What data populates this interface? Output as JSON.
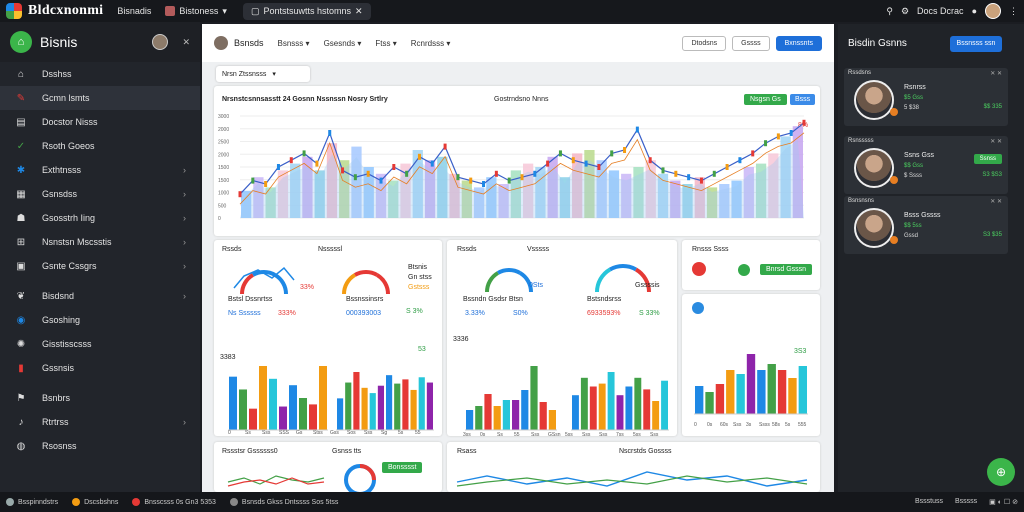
{
  "topbar": {
    "brand": "Bldcxnonmi",
    "menu1": "Bisnadis",
    "menu2": "Bistoness",
    "pill": "Pontstsuwtts hstomns",
    "right_label": "Docs Dcrac"
  },
  "sidebar": {
    "title": "Bisnis",
    "items": [
      {
        "label": "Dsshss",
        "icon": "home-icon"
      },
      {
        "label": "Gcmn lsmts",
        "icon": "pen-icon",
        "active": true
      },
      {
        "label": "Docstor Nisss",
        "icon": "document-icon"
      },
      {
        "label": "Rsoth Goeos",
        "icon": "check-icon"
      },
      {
        "label": "Exthtnsss",
        "icon": "puzzle-icon",
        "chev": true
      },
      {
        "label": "Gsnsdss",
        "icon": "grid-icon",
        "chev": true
      },
      {
        "label": "Gsosstrh Iing",
        "icon": "user-icon",
        "chev": true
      },
      {
        "label": "Nsnstsn Mscsstis",
        "icon": "plus-icon",
        "chev": true
      },
      {
        "label": "Gsnte Cssgrs",
        "icon": "lock-icon",
        "chev": true
      },
      {
        "label": "Bisdsnd",
        "icon": "leaf-icon",
        "chev": true
      },
      {
        "label": "Gsoshing",
        "icon": "circle-icon"
      },
      {
        "label": "Gisstisscsss",
        "icon": "settings-icon"
      },
      {
        "label": "Gssnsis",
        "icon": "chart-icon"
      },
      {
        "label": "Bsnbrs",
        "icon": "flag-icon"
      },
      {
        "label": "Rtrtrss",
        "icon": "bell-icon",
        "chev": true
      },
      {
        "label": "Rsosnss",
        "icon": "globe-icon"
      }
    ]
  },
  "toolbar": {
    "title": "Bsnsds",
    "dd1": "Bsnsss",
    "dd2": "Gsesnds",
    "dd3": "Ftss",
    "dd4": "Rcnrdsss",
    "btn1": "Dtodsns",
    "btn2": "Gssss",
    "btn3": "Bxnssnts"
  },
  "filter": "Nrsn Ztssnsss",
  "main_chart": {
    "title": "Nrsnstcsnnsasstt 24 Gosnn Nssnssn Nosry Srtlry",
    "title2": "Gostrndsno Nnns",
    "btn_green": "Nsgsn Gs",
    "btn_blue": "Bsss",
    "legend_red": "8%",
    "y_ticks": [
      "3000",
      "2000",
      "2500",
      "2000",
      "1500",
      "1500",
      "1000",
      "500",
      "0"
    ]
  },
  "card_a": {
    "t1": "Rssds",
    "t2": "Nsssssl",
    "g1_label": "Bstsl Dssnrtss",
    "g2_label": "Bssnssinsrs",
    "g1_val": "33%",
    "g2_pre": "Gstsss",
    "g1_pct": "333%",
    "g1_sub": "Ns Ssssss",
    "g2_sub": "000393003",
    "g2_pct": "S 3%",
    "g2_top": "Btsnis",
    "g2_top2": "Gn stss",
    "ylab": "3383",
    "bar_top": "53",
    "xlabels": [
      "0",
      "Ss",
      "Sss",
      "SSS",
      "Gs",
      "Stss",
      "Gss",
      "Sos",
      "Sss",
      "Sg",
      "5s",
      "55"
    ]
  },
  "card_b": {
    "t1": "Rssds",
    "t2": "Vsssss",
    "g1_label": "Bssndn Gsdsr Btsn",
    "g2_label": "Bstsndsrss",
    "g1_val": "0Sts",
    "g2_val": "Gssssis",
    "g1_sub": "3.33%",
    "g1_sub2": "S0%",
    "g2_sub": "6933593%",
    "g2_sub2": "S 33%",
    "ylab": "3336",
    "xlabels": [
      "3ss",
      "0s",
      "Ss",
      "55",
      "Sss",
      "GSsn",
      "5ss",
      "Sss",
      "Sss",
      "7ss",
      "5ss",
      "Sss"
    ]
  },
  "card_c": {
    "t1": "Rnsss Ssss",
    "btn": "Bnrsd Gsssn",
    "ylab": "3S3",
    "xlabels": [
      "0",
      "0s",
      "60s",
      "Sss",
      "3s",
      "Ssss",
      "58s",
      "5s",
      "555"
    ]
  },
  "card_d": {
    "t1": "Rssstsr Gssssss0",
    "t2": "Gsnss tts",
    "btn": "Bonsssst",
    "sub": "Brsnsr Bssss",
    "ylab": "6s",
    "ylab2": "1s"
  },
  "card_e": {
    "t1": "Rsass",
    "t2": "Nscrstds Gossss"
  },
  "rpanel": {
    "title": "Bisdin Gsnns",
    "btn": "Bssnsss ssn",
    "people": [
      {
        "name": "Rssdsns",
        "l1": "Rsnrss",
        "l2": "$5 Gss",
        "l3": "5 $38",
        "num": "$$ 335"
      },
      {
        "name": "Rsnsssss",
        "l1": "Ssns Gss",
        "l2": "$$ Gss",
        "l3": "$ Ssss",
        "num": "S3 $S3",
        "btn": "Ssnss"
      },
      {
        "name": "Bsnsnsns",
        "l1": "Bsss Gssss",
        "l2": "$$ 5ss",
        "l3": "Gssd",
        "num": "S3 $35"
      }
    ]
  },
  "statusbar": {
    "s1": "Bsspinndstrs",
    "s2": "Dscsbshns",
    "s3": "Bnsscsss 0s Gn3 5353",
    "s4": "Bsnsds Gkss Dntssss Sos 5tss",
    "r1": "Bssstuss",
    "r2": "Bsssss"
  },
  "chart_data": [
    {
      "type": "bar",
      "title": "Nrsnstcsnnsasstt 24 Gosnn Nssnssn Nosry Srtlry",
      "series": [
        {
          "name": "bars",
          "values": [
            800,
            1200,
            900,
            1400,
            1600,
            1800,
            1400,
            2200,
            1700,
            2100,
            1500,
            1300,
            1100,
            1600,
            2000,
            1700,
            1800,
            1300,
            1100,
            900,
            1200,
            1000,
            1400,
            1600,
            1500,
            1800,
            1200,
            1900,
            2000,
            1700,
            1400,
            1300,
            1500,
            1700,
            1300,
            1100,
            1000,
            1200,
            900,
            1000,
            1100,
            1500,
            1600,
            1900,
            2400,
            2700
          ]
        },
        {
          "name": "line",
          "values": [
            700,
            1100,
            1000,
            1500,
            1700,
            1900,
            1600,
            2500,
            1400,
            1200,
            1300,
            1100,
            1500,
            1300,
            1800,
            1600,
            2100,
            1200,
            1100,
            1000,
            1300,
            1100,
            1200,
            1300,
            1600,
            1900,
            1700,
            1600,
            1500,
            1900,
            2000,
            2600,
            1700,
            1400,
            1300,
            1200,
            1100,
            1300,
            1500,
            1700,
            1900,
            2200,
            2400,
            2500,
            2800
          ]
        }
      ],
      "ylim": [
        0,
        3000
      ]
    },
    {
      "type": "bar",
      "series": [
        {
          "values": [
            50,
            38,
            20,
            60,
            48,
            22,
            42,
            30,
            24,
            60
          ]
        },
        {
          "values": [
            30,
            45,
            55,
            40,
            35,
            42,
            52,
            44,
            48,
            38,
            50,
            45
          ]
        }
      ]
    },
    {
      "type": "bar",
      "series": [
        {
          "values": [
            20,
            24,
            36,
            24,
            30,
            30,
            40,
            64,
            28,
            20
          ]
        },
        {
          "values": [
            24,
            36,
            30,
            32,
            40,
            24,
            30,
            36,
            28,
            20,
            34
          ]
        }
      ]
    },
    {
      "type": "bar",
      "values": [
        28,
        22,
        30,
        44,
        40,
        60,
        44,
        50,
        44,
        36,
        48
      ]
    }
  ]
}
